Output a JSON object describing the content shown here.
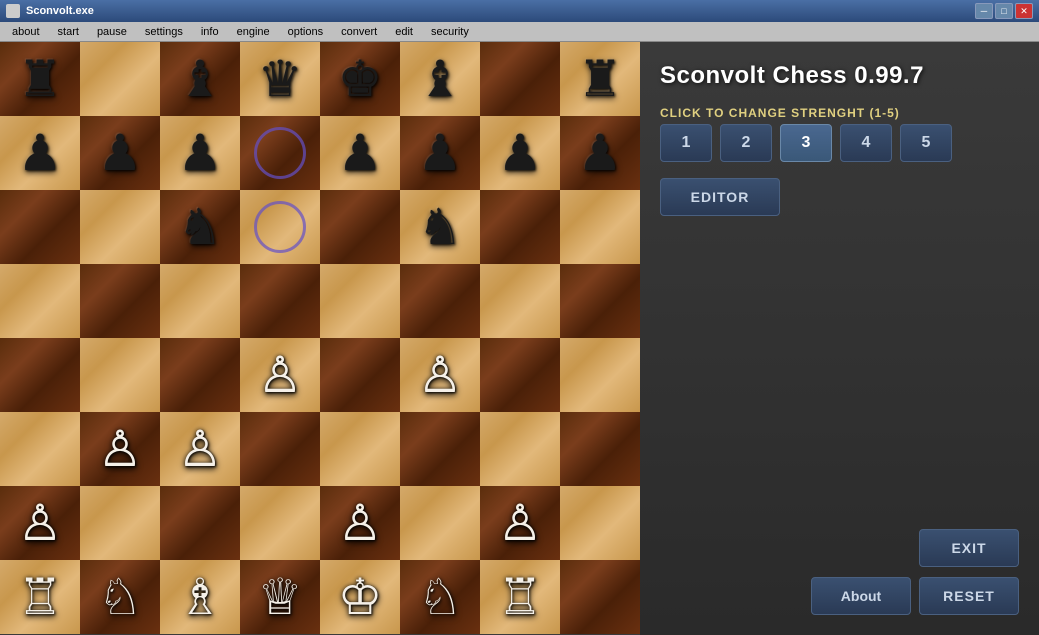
{
  "titlebar": {
    "title": "Sconvolt.exe",
    "min_label": "─",
    "max_label": "□",
    "close_label": "✕"
  },
  "menubar": {
    "items": [
      "about",
      "start",
      "pause",
      "settings",
      "info",
      "engine",
      "options",
      "convert",
      "edit",
      "security"
    ]
  },
  "game": {
    "title": "Sconvolt Chess 0.99.7",
    "strength_label": "CLICK TO CHANGE STRENGHT (1-5)",
    "strength_options": [
      "1",
      "2",
      "3",
      "4",
      "5"
    ],
    "active_strength": 2,
    "editor_label": "EDITOR",
    "exit_label": "EXIT",
    "about_label": "About",
    "reset_label": "RESET"
  },
  "board": {
    "cells": [
      {
        "row": 0,
        "col": 0,
        "color": "dark",
        "piece": "♜",
        "pieceColor": "black"
      },
      {
        "row": 0,
        "col": 1,
        "color": "light",
        "piece": "",
        "pieceColor": ""
      },
      {
        "row": 0,
        "col": 2,
        "color": "dark",
        "piece": "♝",
        "pieceColor": "black"
      },
      {
        "row": 0,
        "col": 3,
        "color": "light",
        "piece": "♛",
        "pieceColor": "black"
      },
      {
        "row": 0,
        "col": 4,
        "color": "dark",
        "piece": "♚",
        "pieceColor": "black"
      },
      {
        "row": 0,
        "col": 5,
        "color": "light",
        "piece": "♝",
        "pieceColor": "black"
      },
      {
        "row": 0,
        "col": 6,
        "color": "dark",
        "piece": "",
        "pieceColor": ""
      },
      {
        "row": 0,
        "col": 7,
        "color": "light",
        "piece": "♜",
        "pieceColor": "black"
      },
      {
        "row": 1,
        "col": 0,
        "color": "light",
        "piece": "♟",
        "pieceColor": "black"
      },
      {
        "row": 1,
        "col": 1,
        "color": "dark",
        "piece": "♟",
        "pieceColor": "black"
      },
      {
        "row": 1,
        "col": 2,
        "color": "light",
        "piece": "♟",
        "pieceColor": "black"
      },
      {
        "row": 1,
        "col": 3,
        "color": "dark",
        "piece": "circle",
        "pieceColor": ""
      },
      {
        "row": 1,
        "col": 4,
        "color": "light",
        "piece": "♟",
        "pieceColor": "black"
      },
      {
        "row": 1,
        "col": 5,
        "color": "dark",
        "piece": "♟",
        "pieceColor": "black"
      },
      {
        "row": 1,
        "col": 6,
        "color": "light",
        "piece": "♟",
        "pieceColor": "black"
      },
      {
        "row": 1,
        "col": 7,
        "color": "dark",
        "piece": "♟",
        "pieceColor": "black"
      },
      {
        "row": 2,
        "col": 0,
        "color": "dark",
        "piece": "",
        "pieceColor": ""
      },
      {
        "row": 2,
        "col": 1,
        "color": "light",
        "piece": "",
        "pieceColor": ""
      },
      {
        "row": 2,
        "col": 2,
        "color": "dark",
        "piece": "♞",
        "pieceColor": "black"
      },
      {
        "row": 2,
        "col": 3,
        "color": "light",
        "piece": "circle",
        "pieceColor": ""
      },
      {
        "row": 2,
        "col": 4,
        "color": "dark",
        "piece": "",
        "pieceColor": ""
      },
      {
        "row": 2,
        "col": 5,
        "color": "light",
        "piece": "♞",
        "pieceColor": "black"
      },
      {
        "row": 2,
        "col": 6,
        "color": "dark",
        "piece": "",
        "pieceColor": ""
      },
      {
        "row": 2,
        "col": 7,
        "color": "light",
        "piece": "",
        "pieceColor": ""
      },
      {
        "row": 3,
        "col": 0,
        "color": "light",
        "piece": "",
        "pieceColor": ""
      },
      {
        "row": 3,
        "col": 1,
        "color": "dark",
        "piece": "",
        "pieceColor": ""
      },
      {
        "row": 3,
        "col": 2,
        "color": "light",
        "piece": "",
        "pieceColor": ""
      },
      {
        "row": 3,
        "col": 3,
        "color": "dark",
        "piece": "",
        "pieceColor": ""
      },
      {
        "row": 3,
        "col": 4,
        "color": "light",
        "piece": "",
        "pieceColor": ""
      },
      {
        "row": 3,
        "col": 5,
        "color": "dark",
        "piece": "",
        "pieceColor": ""
      },
      {
        "row": 3,
        "col": 6,
        "color": "light",
        "piece": "",
        "pieceColor": ""
      },
      {
        "row": 3,
        "col": 7,
        "color": "dark",
        "piece": "",
        "pieceColor": ""
      },
      {
        "row": 4,
        "col": 0,
        "color": "dark",
        "piece": "",
        "pieceColor": ""
      },
      {
        "row": 4,
        "col": 1,
        "color": "light",
        "piece": "",
        "pieceColor": ""
      },
      {
        "row": 4,
        "col": 2,
        "color": "dark",
        "piece": "",
        "pieceColor": ""
      },
      {
        "row": 4,
        "col": 3,
        "color": "light",
        "piece": "♙",
        "pieceColor": "white"
      },
      {
        "row": 4,
        "col": 4,
        "color": "dark",
        "piece": "",
        "pieceColor": ""
      },
      {
        "row": 4,
        "col": 5,
        "color": "light",
        "piece": "♙",
        "pieceColor": "white"
      },
      {
        "row": 4,
        "col": 6,
        "color": "dark",
        "piece": "",
        "pieceColor": ""
      },
      {
        "row": 4,
        "col": 7,
        "color": "light",
        "piece": "",
        "pieceColor": ""
      },
      {
        "row": 5,
        "col": 0,
        "color": "light",
        "piece": "",
        "pieceColor": ""
      },
      {
        "row": 5,
        "col": 1,
        "color": "dark",
        "piece": "♙",
        "pieceColor": "white"
      },
      {
        "row": 5,
        "col": 2,
        "color": "light",
        "piece": "♙",
        "pieceColor": "white"
      },
      {
        "row": 5,
        "col": 3,
        "color": "dark",
        "piece": "",
        "pieceColor": ""
      },
      {
        "row": 5,
        "col": 4,
        "color": "light",
        "piece": "",
        "pieceColor": ""
      },
      {
        "row": 5,
        "col": 5,
        "color": "dark",
        "piece": "",
        "pieceColor": ""
      },
      {
        "row": 5,
        "col": 6,
        "color": "light",
        "piece": "",
        "pieceColor": ""
      },
      {
        "row": 5,
        "col": 7,
        "color": "dark",
        "piece": "",
        "pieceColor": ""
      },
      {
        "row": 6,
        "col": 0,
        "color": "dark",
        "piece": "♙",
        "pieceColor": "white"
      },
      {
        "row": 6,
        "col": 1,
        "color": "light",
        "piece": "",
        "pieceColor": ""
      },
      {
        "row": 6,
        "col": 2,
        "color": "dark",
        "piece": "",
        "pieceColor": ""
      },
      {
        "row": 6,
        "col": 3,
        "color": "light",
        "piece": "",
        "pieceColor": ""
      },
      {
        "row": 6,
        "col": 4,
        "color": "dark",
        "piece": "♙",
        "pieceColor": "white"
      },
      {
        "row": 6,
        "col": 5,
        "color": "light",
        "piece": "",
        "pieceColor": ""
      },
      {
        "row": 6,
        "col": 6,
        "color": "dark",
        "piece": "♙",
        "pieceColor": "white"
      },
      {
        "row": 6,
        "col": 7,
        "color": "light",
        "piece": "",
        "pieceColor": ""
      },
      {
        "row": 7,
        "col": 0,
        "color": "light",
        "piece": "♖",
        "pieceColor": "white"
      },
      {
        "row": 7,
        "col": 1,
        "color": "dark",
        "piece": "♘",
        "pieceColor": "white"
      },
      {
        "row": 7,
        "col": 2,
        "color": "light",
        "piece": "♗",
        "pieceColor": "white"
      },
      {
        "row": 7,
        "col": 3,
        "color": "dark",
        "piece": "♕",
        "pieceColor": "white"
      },
      {
        "row": 7,
        "col": 4,
        "color": "light",
        "piece": "♔",
        "pieceColor": "white"
      },
      {
        "row": 7,
        "col": 5,
        "color": "dark",
        "piece": "♘",
        "pieceColor": "white"
      },
      {
        "row": 7,
        "col": 6,
        "color": "light",
        "piece": "♖",
        "pieceColor": "white"
      },
      {
        "row": 7,
        "col": 7,
        "color": "dark",
        "piece": "",
        "pieceColor": ""
      }
    ]
  }
}
